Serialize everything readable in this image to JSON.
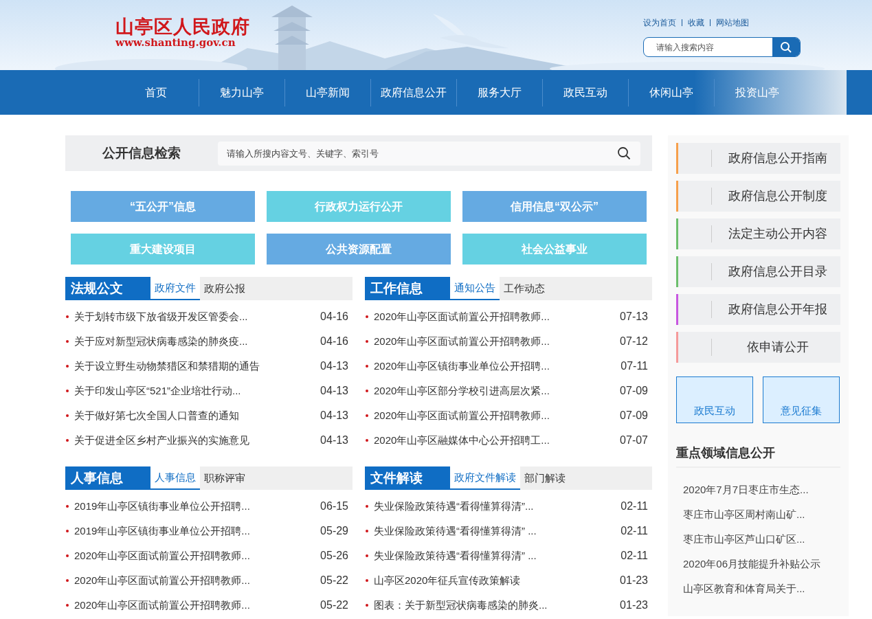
{
  "header": {
    "logo_title": "山亭区人民政府",
    "logo_url": "www.shanting.gov.cn",
    "top_links": [
      "设为首页",
      "收藏",
      "网站地图"
    ],
    "search": {
      "placeholder": "请输入搜索内容"
    }
  },
  "nav": [
    {
      "label": "首页",
      "selected": false
    },
    {
      "label": "魅力山亭",
      "selected": false
    },
    {
      "label": "山亭新闻",
      "selected": false
    },
    {
      "label": "政府信息公开",
      "selected": false
    },
    {
      "label": "服务大厅",
      "selected": false
    },
    {
      "label": "政民互动",
      "selected": false
    },
    {
      "label": "休闲山亭",
      "selected": false
    },
    {
      "label": "投资山亭",
      "selected": false
    }
  ],
  "info_search": {
    "title": "公开信息检索",
    "placeholder": "请输入所搜内容文号、关键字、索引号"
  },
  "tiles": [
    {
      "label": "“五公开”信息",
      "color": "#65aae2"
    },
    {
      "label": "行政权力运行公开",
      "color": "#65d1e2"
    },
    {
      "label": "信用信息“双公示”",
      "color": "#65aae2"
    },
    {
      "label": "重大建设项目",
      "color": "#65d1e2"
    },
    {
      "label": "公共资源配置",
      "color": "#65aae2"
    },
    {
      "label": "社会公益事业",
      "color": "#65d1e2"
    }
  ],
  "panels": [
    {
      "title": "法规公文",
      "tabs": [
        {
          "label": "政府文件",
          "selected": true
        },
        {
          "label": "政府公报",
          "selected": false
        }
      ],
      "items": [
        {
          "title": "关于划转市级下放省级开发区管委会...",
          "date": "04-16"
        },
        {
          "title": "关于应对新型冠状病毒感染的肺炎疫...",
          "date": "04-16"
        },
        {
          "title": "关于设立野生动物禁猎区和禁猎期的通告",
          "date": "04-13"
        },
        {
          "title": "关于印发山亭区“521”企业培壮行动...",
          "date": "04-13"
        },
        {
          "title": "关于做好第七次全国人口普查的通知",
          "date": "04-13"
        },
        {
          "title": "关于促进全区乡村产业振兴的实施意见",
          "date": "04-13"
        }
      ]
    },
    {
      "title": "工作信息",
      "tabs": [
        {
          "label": "通知公告",
          "selected": true
        },
        {
          "label": "工作动态",
          "selected": false
        }
      ],
      "items": [
        {
          "title": "2020年山亭区面试前置公开招聘教师...",
          "date": "07-13"
        },
        {
          "title": "2020年山亭区面试前置公开招聘教师...",
          "date": "07-12"
        },
        {
          "title": "2020年山亭区镇街事业单位公开招聘...",
          "date": "07-11"
        },
        {
          "title": "2020年山亭区部分学校引进高层次紧...",
          "date": "07-09"
        },
        {
          "title": "2020年山亭区面试前置公开招聘教师...",
          "date": "07-09"
        },
        {
          "title": "2020年山亭区融媒体中心公开招聘工...",
          "date": "07-07"
        }
      ]
    },
    {
      "title": "人事信息",
      "tabs": [
        {
          "label": "人事信息",
          "selected": true
        },
        {
          "label": "职称评审",
          "selected": false
        }
      ],
      "items": [
        {
          "title": "2019年山亭区镇街事业单位公开招聘...",
          "date": "06-15"
        },
        {
          "title": "2019年山亭区镇街事业单位公开招聘...",
          "date": "05-29"
        },
        {
          "title": "2020年山亭区面试前置公开招聘教师...",
          "date": "05-26"
        },
        {
          "title": "2020年山亭区面试前置公开招聘教师...",
          "date": "05-22"
        },
        {
          "title": "2020年山亭区面试前置公开招聘教师...",
          "date": "05-22"
        }
      ]
    },
    {
      "title": "文件解读",
      "tabs": [
        {
          "label": "政府文件解读",
          "selected": true
        },
        {
          "label": "部门解读",
          "selected": false
        }
      ],
      "items": [
        {
          "title": "失业保险政策待遇“看得懂算得清”...",
          "date": "02-11"
        },
        {
          "title": "失业保险政策待遇“看得懂算得清” ...",
          "date": "02-11"
        },
        {
          "title": "失业保险政策待遇“看得懂算得清” ...",
          "date": "02-11"
        },
        {
          "title": "山亭区2020年征兵宣传政策解读",
          "date": "01-23"
        },
        {
          "title": "图表：关于新型冠状病毒感染的肺炎...",
          "date": "01-23"
        }
      ]
    }
  ],
  "sidebar": {
    "links": [
      {
        "label": "政府信息公开指南",
        "color": "#f7a04b"
      },
      {
        "label": "政府信息公开制度",
        "color": "#f7a04b"
      },
      {
        "label": "法定主动公开内容",
        "color": "#6cbf6c"
      },
      {
        "label": "政府信息公开目录",
        "color": "#6cbf6c"
      },
      {
        "label": "政府信息公开年报",
        "color": "#c856e0"
      },
      {
        "label": "依申请公开",
        "color": "#f59a9a"
      }
    ],
    "boxes": [
      "政民互动",
      "意见征集"
    ],
    "focus": {
      "title": "重点领域信息公开",
      "items": [
        "2020年7月7日枣庄市生态...",
        "枣庄市山亭区周村南山矿...",
        "枣庄市山亭区芦山口矿区...",
        "2020年06月技能提升补贴公示",
        "山亭区教育和体育局关于..."
      ]
    }
  }
}
